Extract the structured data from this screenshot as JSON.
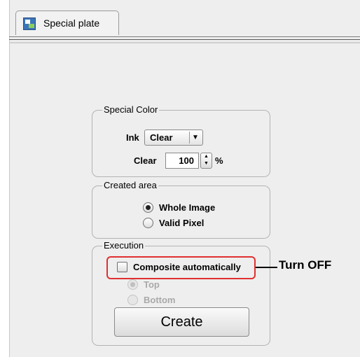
{
  "tab": {
    "label": "Special plate",
    "icon": "special-plate-icon"
  },
  "special_color": {
    "legend": "Special Color",
    "ink_label": "Ink",
    "ink_value": "Clear",
    "clear_label": "Clear",
    "clear_value": "100",
    "percent": "%"
  },
  "created_area": {
    "legend": "Created area",
    "options": [
      {
        "label": "Whole Image",
        "selected": true
      },
      {
        "label": "Valid Pixel",
        "selected": false
      }
    ]
  },
  "execution": {
    "legend": "Execution",
    "composite_label": "Composite automatically",
    "composite_checked": false,
    "options": [
      {
        "label": "Top",
        "selected": true,
        "enabled": false
      },
      {
        "label": "Bottom",
        "selected": false,
        "enabled": false
      }
    ],
    "create_label": "Create"
  },
  "annotation": {
    "label": "Turn OFF",
    "highlight_color": "#e03030"
  }
}
